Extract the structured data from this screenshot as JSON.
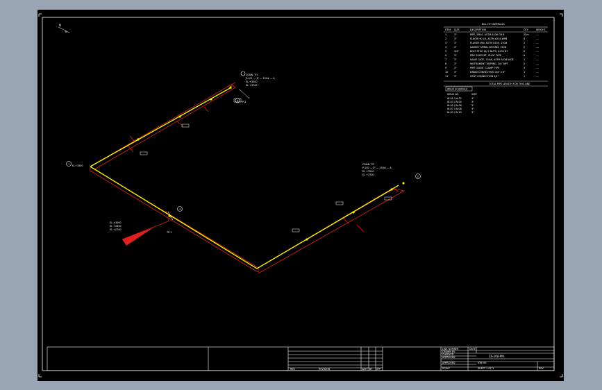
{
  "drawing": {
    "north_label": "N",
    "bom": {
      "title": "BILL OF MATERIALS",
      "headers": [
        "ITEM",
        "SIZE",
        "DESCRIPTION",
        "QTY",
        "WEIGHT"
      ],
      "rows": [
        [
          "1",
          "3\"",
          "PIPE, SMLS, ASTM A106 GR B",
          "25m",
          "---"
        ],
        [
          "2",
          "3\"",
          "ELBOW 90 LR, ASTM A234 WPB",
          "4",
          "---"
        ],
        [
          "3",
          "3\"",
          "FLANGE WN, ASTM A105, 150#",
          "2",
          "---"
        ],
        [
          "4",
          "3\"",
          "GASKET SPIRAL WOUND, 150#",
          "2",
          "---"
        ],
        [
          "5",
          "3/4\"",
          "BOLT STUD W/ 2 NUTS, A193 B7",
          "8",
          "---"
        ],
        [
          "6",
          "3\"",
          "PIPE SUPPORT, SHOE TYPE",
          "6",
          "---"
        ],
        [
          "7",
          "3\"",
          "VALVE GATE, 150#, ASTM A216 WCB",
          "1",
          "---"
        ],
        [
          "8",
          "3\"",
          "INSTRUMENT TAPPING, 3/4\" NPT",
          "2",
          "---"
        ],
        [
          "9",
          "3\"",
          "PIPE GUIDE, CLAMP TYPE",
          "3",
          "---"
        ],
        [
          "10",
          "3\"",
          "DRAIN CONNECTION 3/4\" x 6\"",
          "1",
          "---"
        ],
        [
          "11",
          "3\"",
          "VENT CONNECTION 3/4\"",
          "1",
          "---"
        ]
      ],
      "footer": "TOTAL PIPE LENGTH FOR THIS LINE"
    },
    "weld_table": {
      "title": "WELD SCHEDULE",
      "headers": [
        "WELD NO.",
        "SIZE"
      ],
      "rows": [
        [
          "W-01 / W-02",
          "3\""
        ],
        [
          "W-03 / W-04",
          "3\""
        ],
        [
          "W-05 / W-06",
          "3\""
        ],
        [
          "W-07 / W-08",
          "3\""
        ],
        [
          "W-09 / W-10",
          "3\""
        ]
      ]
    },
    "callouts": {
      "top": [
        "CONN. TO",
        "P-101 — 3\" — 150# — A",
        "EL +3500",
        "EL +3700"
      ],
      "right": [
        "CONN. TO",
        "P-102 — 3\" — 150# — A",
        "EL +3500",
        "EL +3700"
      ],
      "left": [
        "EL +3000",
        "EL +2850",
        "EL +2700"
      ],
      "marker_1": "1",
      "marker_2": "2",
      "marker_3": "3",
      "marker_4": "4",
      "marker_1_tag": "EL+3500",
      "marker_3_tag": "TP-1",
      "marker_4_tag": "TP-2"
    },
    "title_block": {
      "revision_label": "REVISION",
      "rev_cells": [
        "REV",
        "DATE",
        "BY",
        "APP"
      ],
      "fields": [
        "LINE NUMBER",
        "DRAWN BY",
        "CHECKED",
        "APPROVED",
        "APPROVED",
        "SCALE"
      ],
      "col2_labels": [
        "DATE"
      ],
      "drawing_title": "ZS-100-PM",
      "job_no": "JOB NO.",
      "sheet": "SHEET 1 OF 1",
      "rev": "REV"
    }
  }
}
